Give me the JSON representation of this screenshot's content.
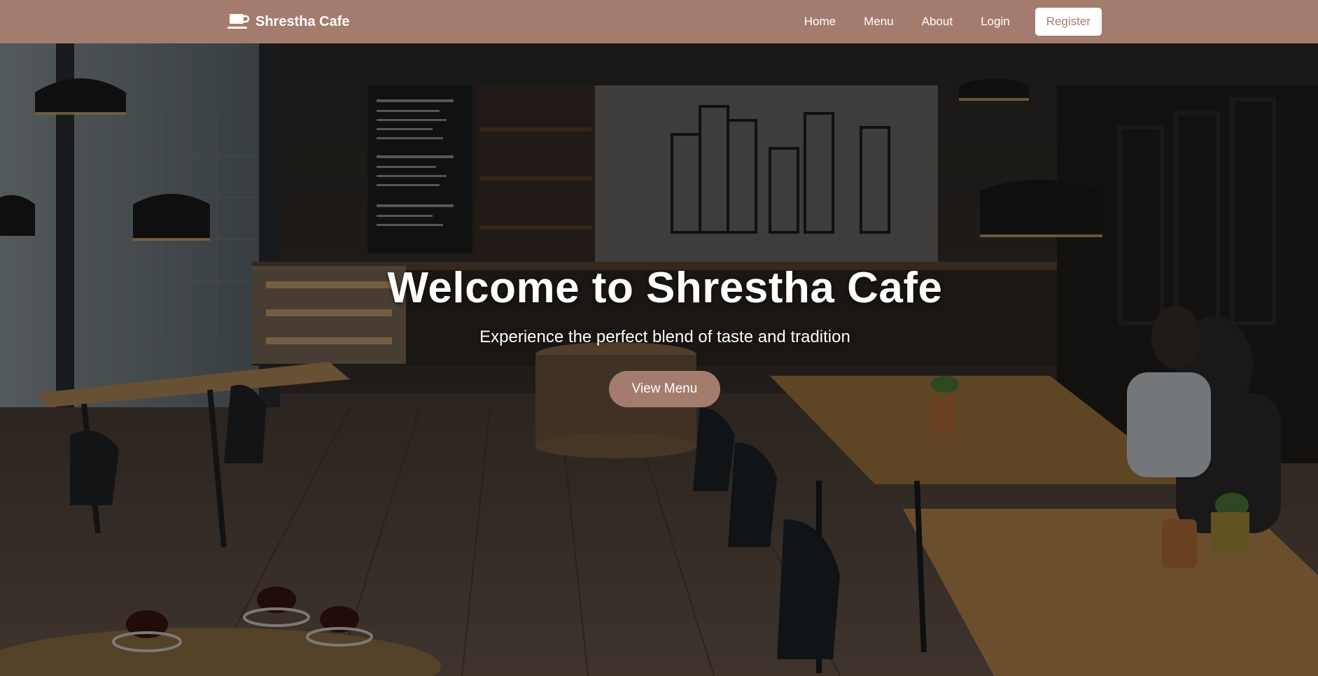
{
  "brand": {
    "name": "Shrestha Cafe",
    "icon": "coffee-cup-icon"
  },
  "nav": {
    "links": [
      "Home",
      "Menu",
      "About",
      "Login"
    ],
    "register_label": "Register"
  },
  "hero": {
    "title": "Welcome to Shrestha Cafe",
    "subtitle": "Experience the perfect blend of taste and tradition",
    "button_label": "View Menu",
    "background_image": "cafe-interior-photo"
  },
  "colors": {
    "accent": "#a47c6e",
    "text_light": "#ffffff"
  }
}
